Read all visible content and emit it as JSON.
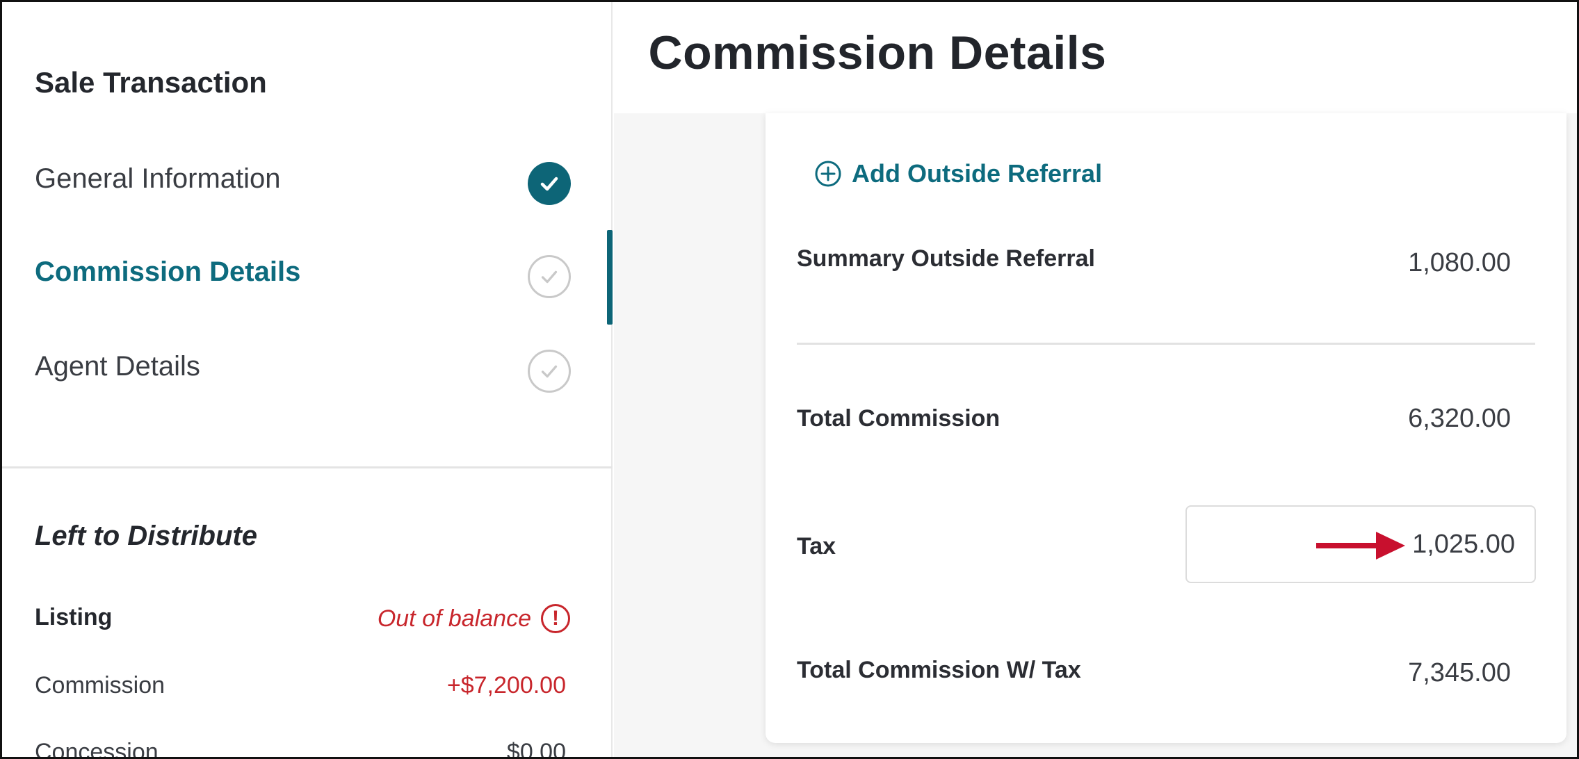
{
  "page_title": "Commission Details",
  "sidebar": {
    "heading": "Sale Transaction",
    "steps": [
      {
        "label": "General Information",
        "state": "complete"
      },
      {
        "label": "Commission Details",
        "state": "current"
      },
      {
        "label": "Agent Details",
        "state": "pending"
      }
    ]
  },
  "left_to_distribute": {
    "heading": "Left to Distribute",
    "listing_label": "Listing",
    "listing_status": "Out of balance",
    "alert_glyph": "!",
    "rows": [
      {
        "label": "Commission",
        "value": "+$7,200.00"
      },
      {
        "label": "Concession",
        "value": "$0.00"
      }
    ]
  },
  "commission_card": {
    "add_referral_label": "Add Outside Referral",
    "summary_outside_referral": {
      "label": "Summary Outside Referral",
      "value": "1,080.00"
    },
    "total_commission": {
      "label": "Total Commission",
      "value": "6,320.00"
    },
    "tax": {
      "label": "Tax",
      "value": "1,025.00"
    },
    "total_with_tax": {
      "label": "Total Commission W/ Tax",
      "value": "7,345.00"
    }
  },
  "colors": {
    "accent": "#0d6577",
    "accent_text": "#0d6b7e",
    "error": "#c8262c",
    "annotation_arrow": "#c8102e"
  },
  "icons": {
    "step_complete": "check-circle-filled-icon",
    "step_pending": "check-circle-outline-icon",
    "add": "plus-circle-icon",
    "alert": "exclamation-circle-icon",
    "annotation": "red-arrow-icon"
  }
}
